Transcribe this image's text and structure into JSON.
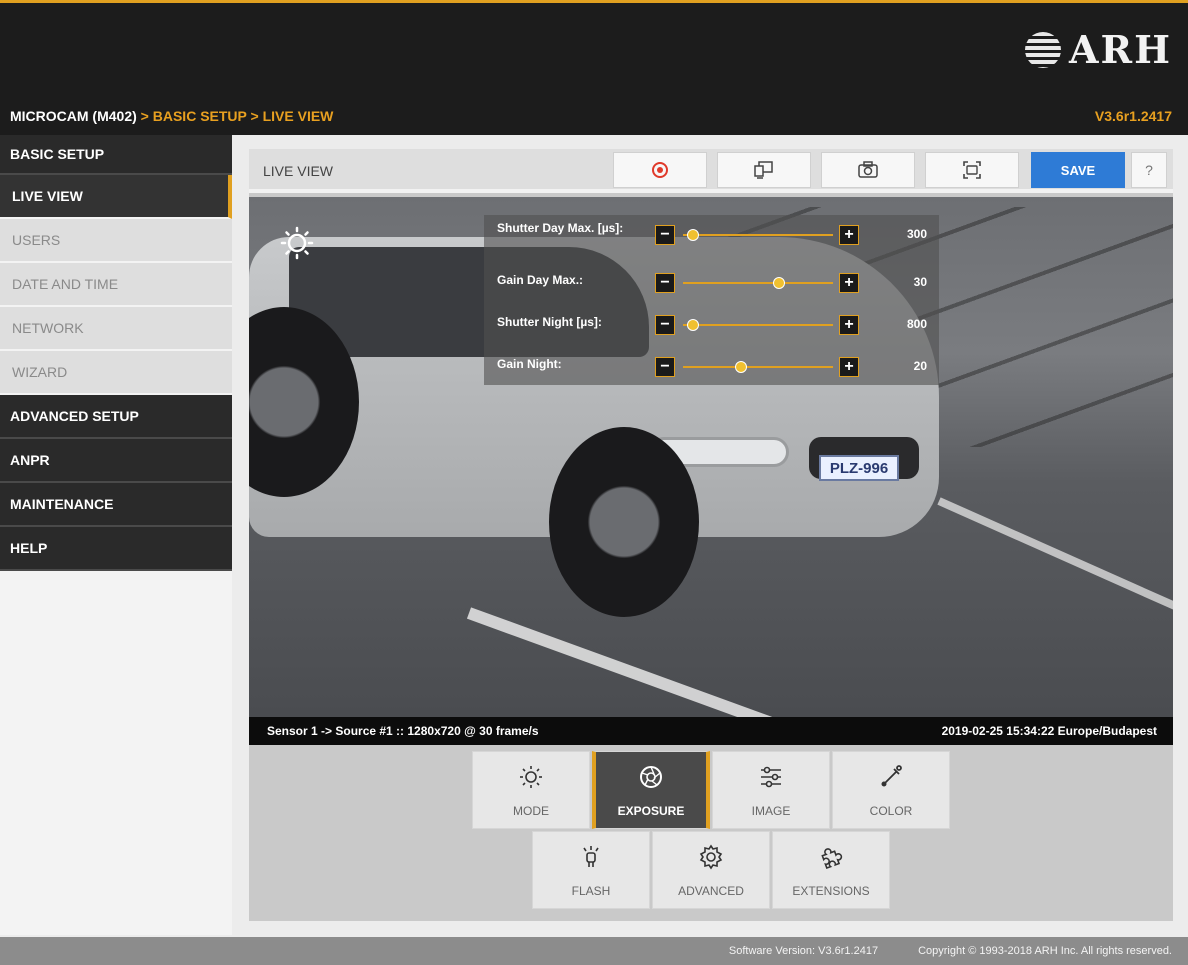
{
  "header": {
    "logo_text": "ARH",
    "breadcrumb": {
      "root": "MICROCAM (M402)",
      "sep": " > ",
      "section": "BASIC SETUP",
      "page": "LIVE VIEW"
    },
    "version": "V3.6r1.2417"
  },
  "sidebar": {
    "groups": [
      {
        "label": "BASIC SETUP",
        "items": [
          "LIVE VIEW",
          "USERS",
          "DATE AND TIME",
          "NETWORK",
          "WIZARD"
        ]
      },
      {
        "label": "ADVANCED SETUP"
      },
      {
        "label": "ANPR"
      },
      {
        "label": "MAINTENANCE"
      },
      {
        "label": "HELP"
      }
    ],
    "active_item": "LIVE VIEW"
  },
  "toolbar": {
    "title": "LIVE VIEW",
    "icons": [
      "record-icon",
      "display-icon",
      "snapshot-icon",
      "fullscreen-icon"
    ],
    "save_label": "SAVE",
    "help_label": "?"
  },
  "exposure_panel": {
    "icon": "brightness-icon",
    "sliders": [
      {
        "label": "Shutter Day Max. [µs]:",
        "value": "300",
        "position": 0.03
      },
      {
        "label": "Gain Day Max.:",
        "value": "30",
        "position": 0.65
      },
      {
        "label": "Shutter Night [µs]:",
        "value": "800",
        "position": 0.03
      },
      {
        "label": "Gain Night:",
        "value": "20",
        "position": 0.38
      }
    ]
  },
  "camera": {
    "plate": "PLZ-996",
    "source_info": "Sensor 1 -> Source #1 :: 1280x720 @ 30 frame/s",
    "timestamp": "2019-02-25 15:34:22 Europe/Budapest"
  },
  "modes": {
    "row1": [
      "MODE",
      "EXPOSURE",
      "IMAGE",
      "COLOR"
    ],
    "row2": [
      "FLASH",
      "ADVANCED",
      "EXTENSIONS"
    ],
    "active": "EXPOSURE"
  },
  "footer": {
    "software_version": "Software Version:   V3.6r1.2417",
    "copyright": "Copyright © 1993-2018 ARH Inc. All rights reserved."
  },
  "colors": {
    "accent": "#e0a020",
    "save_blue": "#2e7bd6",
    "dark": "#1c1c1c"
  }
}
